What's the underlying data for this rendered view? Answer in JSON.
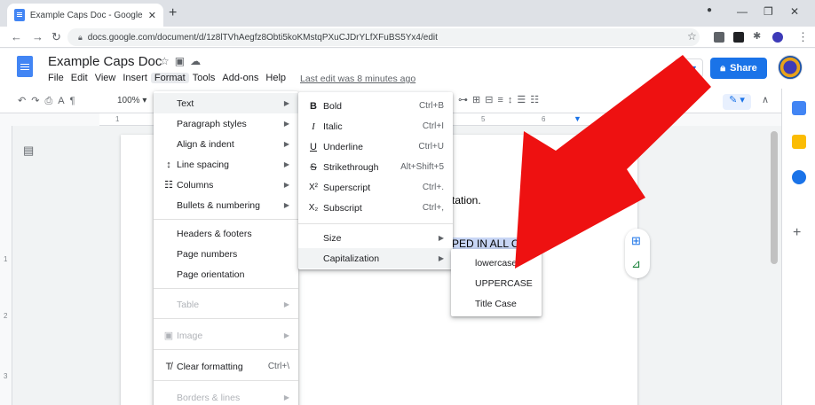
{
  "browser": {
    "tab_title": "Example Caps Doc - Google Doc",
    "tab_close": "✕",
    "new_tab": "+",
    "url": "docs.google.com/document/d/1z8lTVhAegfz8Obti5koKMstqPXuCJDrYLfXFuBS5Yx4/edit"
  },
  "docs": {
    "title": "Example Caps Doc",
    "last_edit": "Last edit was 8 minutes ago",
    "share_label": "Share",
    "zoom": "100%",
    "menus": [
      "File",
      "Edit",
      "View",
      "Insert",
      "Format",
      "Tools",
      "Add-ons",
      "Help"
    ]
  },
  "format_menu": {
    "items": [
      {
        "label": "Text",
        "arrow": "▶"
      },
      {
        "label": "Paragraph styles",
        "arrow": "▶"
      },
      {
        "label": "Align & indent",
        "arrow": "▶"
      },
      {
        "label": "Line spacing",
        "arrow": "▶"
      },
      {
        "label": "Columns",
        "arrow": "▶"
      },
      {
        "label": "Bullets & numbering",
        "arrow": "▶"
      },
      {
        "label": "Headers & footers"
      },
      {
        "label": "Page numbers"
      },
      {
        "label": "Page orientation"
      },
      {
        "label": "Table",
        "arrow": "▶"
      },
      {
        "label": "Image",
        "arrow": "▶"
      },
      {
        "label": "Clear formatting",
        "shortcut": "Ctrl+\\"
      },
      {
        "label": "Borders & lines",
        "arrow": "▶"
      }
    ]
  },
  "text_menu": {
    "items": [
      {
        "icon": "B",
        "label": "Bold",
        "shortcut": "Ctrl+B"
      },
      {
        "icon": "I",
        "label": "Italic",
        "shortcut": "Ctrl+I"
      },
      {
        "icon": "U",
        "label": "Underline",
        "shortcut": "Ctrl+U"
      },
      {
        "icon": "S",
        "label": "Strikethrough",
        "shortcut": "Alt+Shift+5"
      },
      {
        "icon": "X²",
        "label": "Superscript",
        "shortcut": "Ctrl+."
      },
      {
        "icon": "X₂",
        "label": "Subscript",
        "shortcut": "Ctrl+,"
      },
      {
        "label": "Size",
        "arrow": "▶"
      },
      {
        "label": "Capitalization",
        "arrow": "▶"
      }
    ]
  },
  "caps_menu": {
    "items": [
      "lowercase",
      "UPPERCASE",
      "Title Case"
    ]
  },
  "document": {
    "line1_fragment": "tation.",
    "line2_fragment": "PED IN ALL C"
  },
  "ruler": {
    "marks": [
      "1",
      "5",
      "6"
    ]
  },
  "vruler": {
    "marks": [
      "1",
      "2",
      "3"
    ]
  },
  "colors": {
    "arrow": "#ee1111",
    "accent": "#1a73e8",
    "highlight": "#c8d6f5"
  }
}
